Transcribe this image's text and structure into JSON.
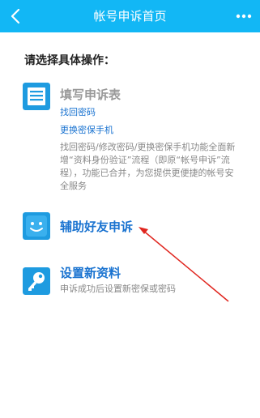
{
  "header": {
    "title": "帐号申诉首页",
    "back_icon": "chevron-left-icon",
    "more_icon": "more-dots-icon",
    "bg_color": "#12b7f5"
  },
  "prompt": "请选择具体操作：",
  "options": [
    {
      "icon": "form-list-icon",
      "title": "填写申诉表",
      "links": [
        "找回密码",
        "更换密保手机"
      ],
      "description": "找回密码/修改密码/更换密保手机功能全面新增“资料身份验证”流程（即原“帐号申诉”流程），功能已合并，为您提供更便捷的帐号安全服务"
    },
    {
      "icon": "smiley-face-icon",
      "title": "辅助好友申诉"
    },
    {
      "icon": "key-icon",
      "title": "设置新资料",
      "description": "申诉成功后设置新密保或密码"
    }
  ],
  "colors": {
    "accent_blue": "#12b7f5",
    "link_blue": "#1a73d0",
    "title_grey": "#999999",
    "annotation_red": "#e0261f"
  }
}
